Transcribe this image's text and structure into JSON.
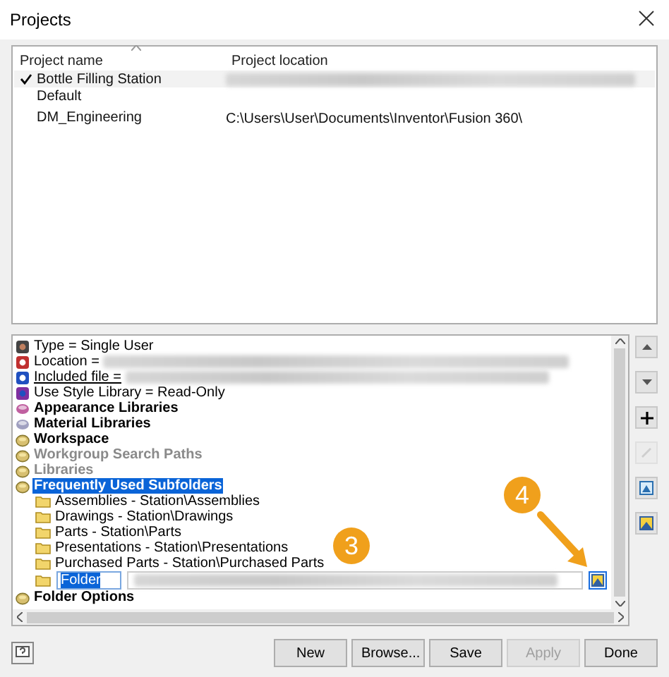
{
  "window": {
    "title": "Projects"
  },
  "projects": {
    "columns": [
      "Project name",
      "Project location"
    ],
    "rows": [
      {
        "name": "Bottle Filling Station",
        "active": true,
        "selected": true,
        "location_redacted": true
      },
      {
        "name": "Default",
        "active": false,
        "selected": false,
        "location_redacted": false
      },
      {
        "name": "DM_Engineering",
        "active": false,
        "selected": false,
        "location_redacted": false,
        "location": "C:\\Users\\User\\Documents\\Inventor\\Fusion 360\\"
      }
    ]
  },
  "settings": [
    {
      "kind": "setting",
      "label": "Type = Single User",
      "redacted": false
    },
    {
      "kind": "setting",
      "label": "Location =",
      "redacted": true
    },
    {
      "kind": "link",
      "label": "Included file =",
      "redacted": true
    },
    {
      "kind": "setting",
      "label": "Use Style Library = Read-Only",
      "redacted": false
    },
    {
      "kind": "group",
      "label": "Appearance Libraries",
      "disabled": false,
      "selected": false
    },
    {
      "kind": "group",
      "label": "Material Libraries",
      "disabled": false,
      "selected": false
    },
    {
      "kind": "group",
      "label": "Workspace",
      "disabled": false,
      "selected": false
    },
    {
      "kind": "group",
      "label": "Workgroup Search Paths",
      "disabled": true,
      "selected": false
    },
    {
      "kind": "group",
      "label": "Libraries",
      "disabled": true,
      "selected": false
    },
    {
      "kind": "group",
      "label": "Frequently Used Subfolders",
      "disabled": false,
      "selected": true,
      "children": [
        {
          "kind": "folder",
          "label": "Assemblies - Station\\Assemblies"
        },
        {
          "kind": "folder",
          "label": "Drawings - Station\\Drawings"
        },
        {
          "kind": "folder",
          "label": "Parts - Station\\Parts"
        },
        {
          "kind": "folder",
          "label": "Presentations - Station\\Presentations"
        },
        {
          "kind": "folder",
          "label": "Purchased Parts - Station\\Purchased Parts"
        },
        {
          "kind": "edit",
          "value": "Folder"
        }
      ]
    },
    {
      "kind": "group",
      "label": "Folder Options",
      "disabled": false,
      "selected": false
    }
  ],
  "side_buttons": [
    {
      "kind": "up",
      "disabled": false
    },
    {
      "kind": "down",
      "disabled": false
    },
    {
      "kind": "add",
      "disabled": false
    },
    {
      "kind": "edit",
      "disabled": true
    },
    {
      "kind": "pick",
      "disabled": false
    },
    {
      "kind": "image",
      "disabled": false
    }
  ],
  "callouts": [
    "3",
    "4"
  ],
  "buttons": [
    {
      "label": "New",
      "disabled": false
    },
    {
      "label": "Browse...",
      "disabled": false
    },
    {
      "label": "Save",
      "disabled": false
    },
    {
      "label": "Apply",
      "disabled": true
    },
    {
      "label": "Done",
      "disabled": false
    }
  ]
}
